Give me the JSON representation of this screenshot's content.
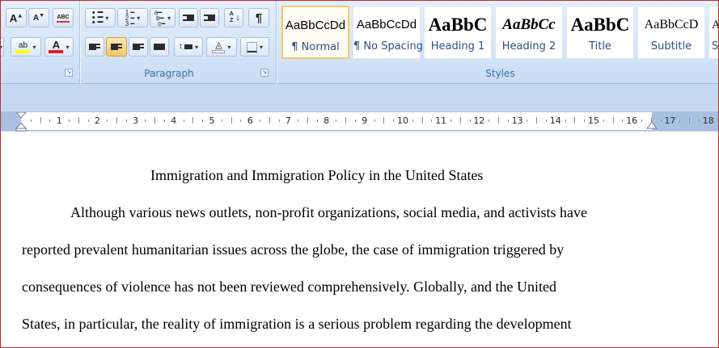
{
  "ribbon": {
    "font_group": {
      "grow_font": "A",
      "shrink_font": "A",
      "clear_format": "ABC",
      "highlight_label": "ab",
      "font_color_label": "A",
      "highlight_color": "#ffff00",
      "font_color": "#e31b23"
    },
    "paragraph_group": {
      "label": "Paragraph",
      "pilcrow": "¶",
      "sort_label": "A Z"
    },
    "styles_group": {
      "label": "Styles",
      "items": [
        {
          "preview": "AaBbCcDd",
          "name": "¶ Normal"
        },
        {
          "preview": "AaBbCcDd",
          "name": "¶ No Spacing"
        },
        {
          "preview": "AaBbC",
          "name": "Heading 1"
        },
        {
          "preview": "AaBbCc",
          "name": "Heading 2"
        },
        {
          "preview": "AaBbC",
          "name": "Title"
        },
        {
          "preview": "AaBbCcD",
          "name": "Subtitle"
        },
        {
          "preview": "A",
          "name": "S"
        }
      ]
    }
  },
  "ruler": {
    "numbers": [
      "1",
      "2",
      "3",
      "4",
      "5",
      "6",
      "7",
      "8",
      "9",
      "10",
      "11",
      "12",
      "13",
      "14",
      "15",
      "16",
      "17",
      "18"
    ]
  },
  "document": {
    "title": "Immigration and Immigration Policy in the United States",
    "lines": [
      "Although various news outlets, non-profit organizations, social media, and activists have",
      "reported prevalent humanitarian issues across the globe, the case of immigration triggered by",
      "consequences of violence has not been reviewed comprehensively. Globally, and the United",
      "States, in particular, the reality of immigration is a serious problem regarding the development"
    ]
  }
}
